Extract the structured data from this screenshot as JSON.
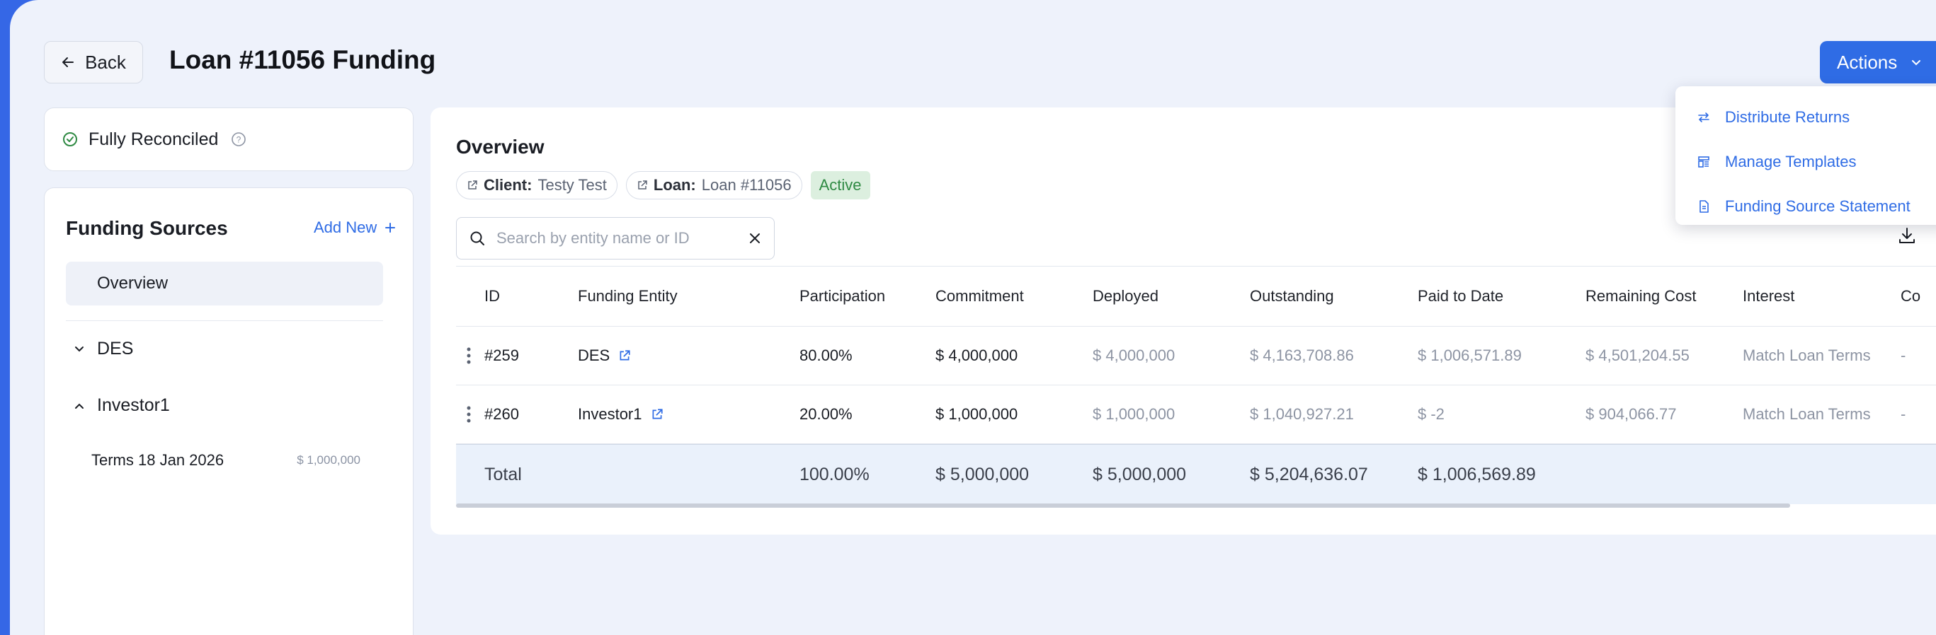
{
  "header": {
    "back_label": "Back",
    "title": "Loan #11056 Funding",
    "actions_label": "Actions"
  },
  "actions_menu": [
    {
      "label": "Distribute Returns",
      "icon": "arrows-swap-icon"
    },
    {
      "label": "Manage Templates",
      "icon": "template-icon"
    },
    {
      "label": "Funding Source Statement",
      "icon": "document-icon"
    }
  ],
  "reconciliation": {
    "label": "Fully Reconciled"
  },
  "funding_sources": {
    "title": "Funding Sources",
    "add_new_label": "Add New",
    "overview_label": "Overview",
    "groups": [
      {
        "label": "DES",
        "expanded": false
      },
      {
        "label": "Investor1",
        "expanded": true
      }
    ],
    "terms": [
      {
        "label": "Terms 18 Jan 2026",
        "amount": "$ 1,000,000"
      }
    ]
  },
  "overview": {
    "title": "Overview",
    "client_key": "Client:",
    "client_value": "Testy Test",
    "loan_key": "Loan:",
    "loan_value": "Loan #11056",
    "status": "Active",
    "search_placeholder": "Search by entity name or ID"
  },
  "table": {
    "columns": [
      "ID",
      "Funding Entity",
      "Participation",
      "Commitment",
      "Deployed",
      "Outstanding",
      "Paid to Date",
      "Remaining Cost",
      "Interest",
      "Co"
    ],
    "rows": [
      {
        "id": "#259",
        "entity": "DES",
        "participation": "80.00%",
        "commitment": "$ 4,000,000",
        "deployed": "$ 4,000,000",
        "outstanding": "$ 4,163,708.86",
        "paid": "$ 1,006,571.89",
        "remaining": "$ 4,501,204.55",
        "interest": "Match Loan Terms",
        "co": "-"
      },
      {
        "id": "#260",
        "entity": "Investor1",
        "participation": "20.00%",
        "commitment": "$ 1,000,000",
        "deployed": "$ 1,000,000",
        "outstanding": "$ 1,040,927.21",
        "paid": "$ -2",
        "remaining": "$ 904,066.77",
        "interest": "Match Loan Terms",
        "co": "-"
      }
    ],
    "total": {
      "label": "Total",
      "participation": "100.00%",
      "commitment": "$ 5,000,000",
      "deployed": "$ 5,000,000",
      "outstanding": "$ 5,204,636.07",
      "paid": "$ 1,006,569.89"
    }
  },
  "colors": {
    "accent": "#2f6ce5",
    "sidebar": "#3567e6",
    "active_badge_bg": "#dcefdf",
    "active_badge_text": "#2f8a43"
  }
}
